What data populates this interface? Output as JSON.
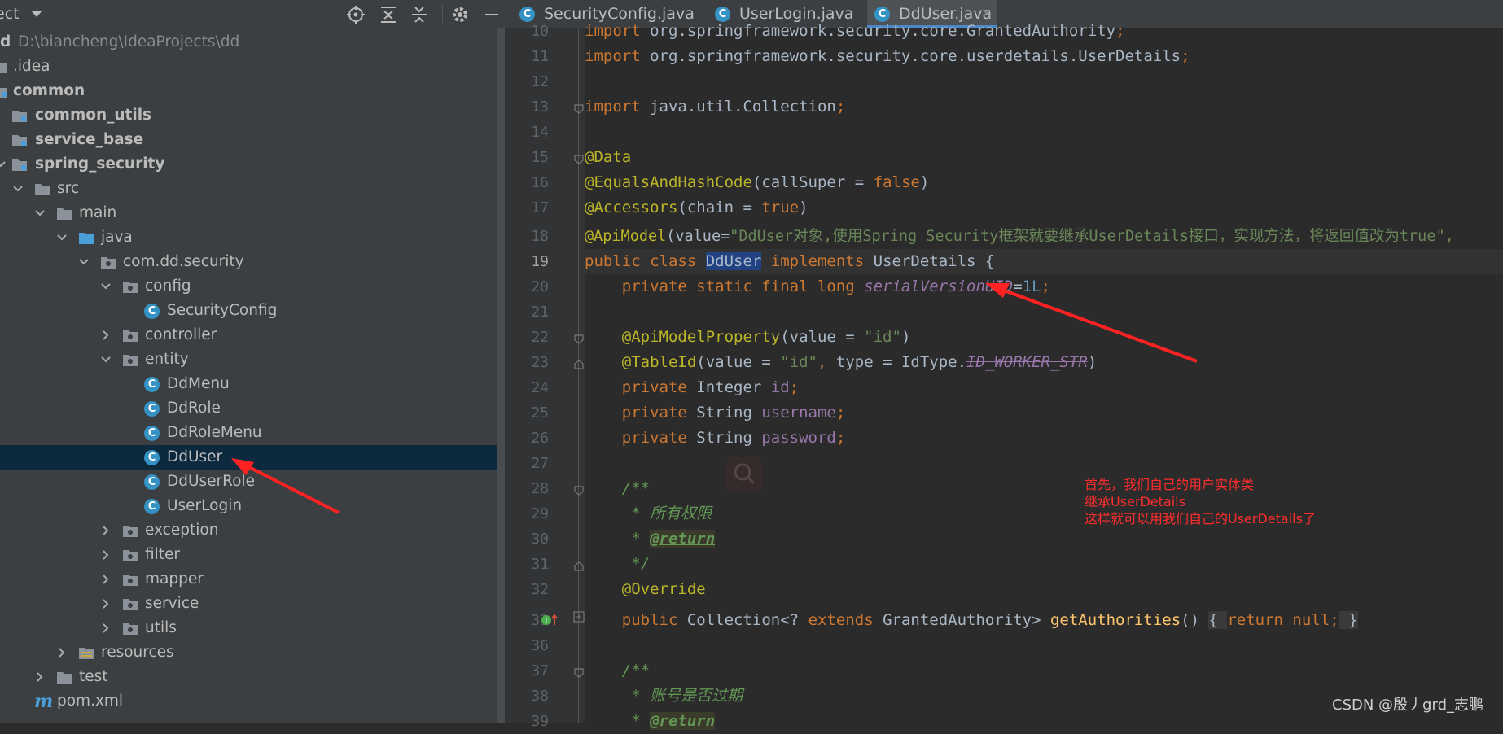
{
  "project": {
    "title": "ect",
    "root": "d",
    "root_path": "D:\\biancheng\\IdeaProjects\\dd",
    "tree": {
      "idea": ".idea",
      "common": "common",
      "common_utils": "common_utils",
      "service_base": "service_base",
      "spring_security": "spring_security",
      "src": "src",
      "main": "main",
      "java": "java",
      "package": "com.dd.security",
      "config": "config",
      "security_config": "SecurityConfig",
      "controller": "controller",
      "entity": "entity",
      "dd_menu": "DdMenu",
      "dd_role": "DdRole",
      "dd_role_menu": "DdRoleMenu",
      "dd_user": "DdUser",
      "dd_user_role": "DdUserRole",
      "user_login": "UserLogin",
      "exception": "exception",
      "filter": "filter",
      "mapper": "mapper",
      "service": "service",
      "utils": "utils",
      "resources": "resources",
      "test": "test",
      "pom": "pom.xml"
    },
    "class_icon": "C"
  },
  "tabs": [
    {
      "label": "SecurityConfig.java",
      "active": false
    },
    {
      "label": "UserLogin.java",
      "active": false
    },
    {
      "label": "DdUser.java",
      "active": true
    }
  ],
  "editor": {
    "line_numbers": [
      "10",
      "11",
      "12",
      "13",
      "14",
      "15",
      "16",
      "17",
      "18",
      "19",
      "20",
      "21",
      "22",
      "23",
      "24",
      "25",
      "26",
      "27",
      "28",
      "29",
      "30",
      "31",
      "32",
      "33",
      "36",
      "37",
      "38",
      "39"
    ],
    "lines": {
      "l10": {
        "kw": "import",
        "rest": " org.springframework.security.core.GrantedAuthority",
        "semi": ";"
      },
      "l11": {
        "kw": "import",
        "rest": " org.springframework.security.core.userdetails.UserDetails",
        "semi": ";"
      },
      "l13": {
        "kw": "import",
        "rest": " java.util.Collection",
        "semi": ";"
      },
      "l15": {
        "ann": "@Data"
      },
      "l16": {
        "ann": "@EqualsAndHashCode",
        "a": "(callSuper = ",
        "kw": "false",
        "b": ")"
      },
      "l17": {
        "ann": "@Accessors",
        "a": "(chain = ",
        "kw": "true",
        "b": ")"
      },
      "l18": {
        "ann": "@ApiModel",
        "a": "(value=",
        "str": "\"DdUser对象,使用Spring Security框架就要继承UserDetails接口，实现方法，将返回值改为true\","
      },
      "l19": {
        "kw1": "public class ",
        "name": "DdUser",
        "kw2": " implements ",
        "rest": "UserDetails {"
      },
      "l20": {
        "kw": "    private static final long ",
        "field": "serialVersionUID",
        "eq": "=",
        "num": "1L",
        "semi": ";"
      },
      "l22": {
        "ann": "    @ApiModelProperty",
        "a": "(value = ",
        "str": "\"id\"",
        "b": ")"
      },
      "l23": {
        "ann": "    @TableId",
        "a": "(value = ",
        "str": "\"id\"",
        "comma": ", ",
        "b": "type = IdType.",
        "const": "ID_WORKER_STR",
        "c": ")"
      },
      "l24": {
        "kw": "    private ",
        "type": "Integer ",
        "field": "id",
        "semi": ";"
      },
      "l25": {
        "kw": "    private ",
        "type": "String ",
        "field": "username",
        "semi": ";"
      },
      "l26": {
        "kw": "    private ",
        "type": "String ",
        "field": "password",
        "semi": ";"
      },
      "l28": {
        "doc": "    /**"
      },
      "l29": {
        "doc": "     * 所有权限"
      },
      "l30": {
        "doc": "     * ",
        "tag": "@return"
      },
      "l31": {
        "doc": "     */"
      },
      "l32": {
        "ann": "    @Override"
      },
      "l33": {
        "kw": "    public ",
        "type": "Collection<? ",
        "kw2": "extends ",
        "type2": "GrantedAuthority> ",
        "method": "getAuthorities",
        "paren": "() ",
        "brace1": "{ ",
        "ret": "return null;",
        "brace2": " }"
      },
      "l37": {
        "doc": "    /**"
      },
      "l38": {
        "doc": "     * 账号是否过期"
      },
      "l39": {
        "doc": "     * ",
        "tag": "@return"
      }
    }
  },
  "annotation": {
    "line1": "首先，我们自己的用户实体类",
    "line2": "继承UserDetails",
    "line3": "这样就可以用我们自己的UserDetails了"
  },
  "watermark": "CSDN @殷丿grd_志鹏",
  "colors": {
    "panel_bg": "#3c3f41",
    "editor_bg": "#2b2b2b",
    "selection": "#0d293e",
    "annotation_red": "#ff2d2d"
  }
}
